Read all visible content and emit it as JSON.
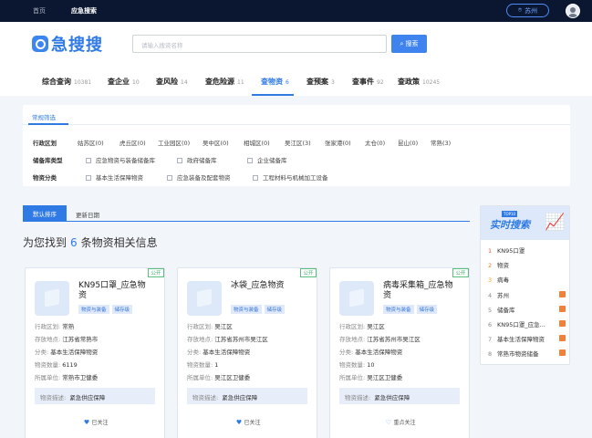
{
  "topbar": {
    "nav": [
      "首页",
      "应急搜索"
    ],
    "location": "苏州"
  },
  "header": {
    "logo_text": "急搜搜",
    "search_placeholder": "请输入搜资名称",
    "search_button": "搜索",
    "tabs": [
      {
        "label": "综合查询",
        "count": "10381"
      },
      {
        "label": "查企业",
        "count": "10"
      },
      {
        "label": "查风险",
        "count": "14"
      },
      {
        "label": "查危险源",
        "count": "11"
      },
      {
        "label": "查物资",
        "count": "6"
      },
      {
        "label": "查预案",
        "count": "3"
      },
      {
        "label": "查事件",
        "count": "92"
      },
      {
        "label": "查政策",
        "count": "10245"
      }
    ]
  },
  "filter": {
    "title": "常规筛选",
    "region_label": "行政区划",
    "regions": [
      "姑苏区(0)",
      "虎丘区(0)",
      "工业园区(0)",
      "吴中区(0)",
      "相城区(0)",
      "吴江区(3)",
      "张家港(0)",
      "太仓(0)",
      "昆山(0)",
      "常熟(3)"
    ],
    "store_label": "储备库类型",
    "stores": [
      "应急物资与装备储备库",
      "政府储备库",
      "企业储备库"
    ],
    "category_label": "物资分类",
    "categories": [
      "基本生活保障物资",
      "应急装备及配套物资",
      "工程材料与机械加工设备"
    ]
  },
  "sort": {
    "default": "默认排序",
    "updated": "更新日期"
  },
  "result": {
    "prefix": "为您找到",
    "count": "6",
    "suffix": "条物资相关信息"
  },
  "cards": [
    {
      "public": "公开",
      "name": "KN95口罩_应急物资",
      "tags": [
        "物资与装备",
        "储存级"
      ],
      "region": "常熟",
      "location": "江苏省常熟市",
      "category": "基本生活保障物资",
      "quantity": "6119",
      "unit": "常熟市卫健委",
      "desc": "紧急供应保障",
      "follow": "已关注"
    },
    {
      "public": "公开",
      "name": "冰袋_应急物资",
      "tags": [
        "物资与装备",
        "储存级"
      ],
      "region": "吴江区",
      "location": "江苏省苏州市吴江区",
      "category": "基本生活保障物资",
      "quantity": "1",
      "unit": "吴江区卫健委",
      "desc": "紧急供应保障",
      "follow": "已关注"
    },
    {
      "public": "公开",
      "name": "病毒采集箱_应急物资",
      "tags": [
        "物资与装备",
        "储存级"
      ],
      "region": "吴江区",
      "location": "江苏省苏州市吴江区",
      "category": "基本生活保障物资",
      "quantity": "10",
      "unit": "吴江区卫健委",
      "desc": "紧急供应保障",
      "follow": "重点关注"
    }
  ],
  "labels": {
    "region": "行政区划:",
    "location": "存放地点:",
    "category": "分类:",
    "quantity": "物资数量:",
    "unit": "所属单位:",
    "desc": "物资描述:"
  },
  "side": {
    "tag": "TOP10",
    "title": "实时搜索",
    "items": [
      "KN95口罩",
      "物资",
      "病毒",
      "苏州",
      "储备库",
      "KN95口罩_应急...",
      "基本生活保障物资",
      "常熟市物资储备"
    ]
  }
}
